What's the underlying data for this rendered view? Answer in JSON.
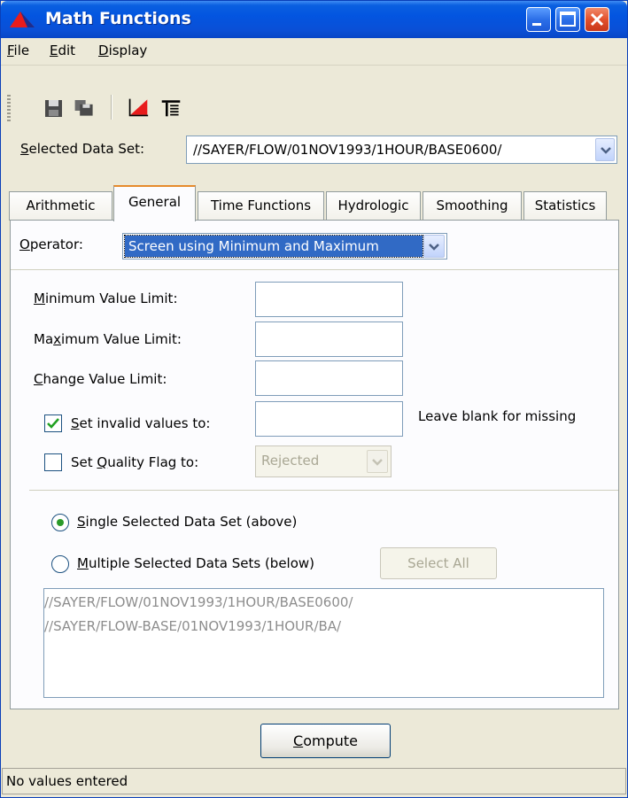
{
  "window": {
    "title": "Math Functions"
  },
  "menu": {
    "items": [
      {
        "label": "File",
        "mnemonic": "F",
        "rest": "ile"
      },
      {
        "label": "Edit",
        "mnemonic": "E",
        "rest": "dit"
      },
      {
        "label": "Display",
        "mnemonic": "D",
        "rest": "isplay"
      }
    ]
  },
  "toolbar": {
    "icons": [
      "save-icon",
      "save-as-icon",
      "plot-icon",
      "tabulate-icon"
    ]
  },
  "selected_data_set": {
    "label_mnemonic": "S",
    "label_rest": "elected Data Set:",
    "value": "//SAYER/FLOW/01NOV1993/1HOUR/BASE0600/"
  },
  "tabs": [
    "Arithmetic",
    "General",
    "Time Functions",
    "Hydrologic",
    "Smoothing",
    "Statistics"
  ],
  "active_tab": "General",
  "operator": {
    "label_mnemonic": "O",
    "label_rest": "perator:",
    "value": "Screen using Minimum and Maximum"
  },
  "fields": {
    "min_mnemonic": "M",
    "min_rest": "inimum Value Limit:",
    "min_value": "",
    "max_pre": "Ma",
    "max_mnemonic": "x",
    "max_rest": "imum Value Limit:",
    "max_value": "",
    "change_mnemonic": "C",
    "change_rest": "hange Value Limit:",
    "change_value": ""
  },
  "invalid": {
    "checked": true,
    "label_mnemonic": "S",
    "label_rest": "et invalid values to:",
    "value": "",
    "hint": "Leave blank for missing"
  },
  "quality": {
    "checked": false,
    "label_pre": "Set ",
    "label_mnemonic": "Q",
    "label_rest": "uality Flag to:",
    "value": "Rejected"
  },
  "scope": {
    "single_mnemonic": "S",
    "single_rest": "ingle Selected Data Set (above)",
    "multiple_mnemonic": "M",
    "multiple_rest": "ultiple Selected Data Sets (below)",
    "selected": "single",
    "select_all_label": "Select All"
  },
  "data_sets": [
    "//SAYER/FLOW/01NOV1993/1HOUR/BASE0600/",
    "//SAYER/FLOW-BASE/01NOV1993/1HOUR/BA/"
  ],
  "compute": {
    "mnemonic": "C",
    "rest": "ompute"
  },
  "status": "No values entered",
  "colors": {
    "titlebar": "#0355e0",
    "selection": "#316ac5",
    "tab_highlight": "#e68b2c",
    "window_bg": "#ece9d8"
  }
}
